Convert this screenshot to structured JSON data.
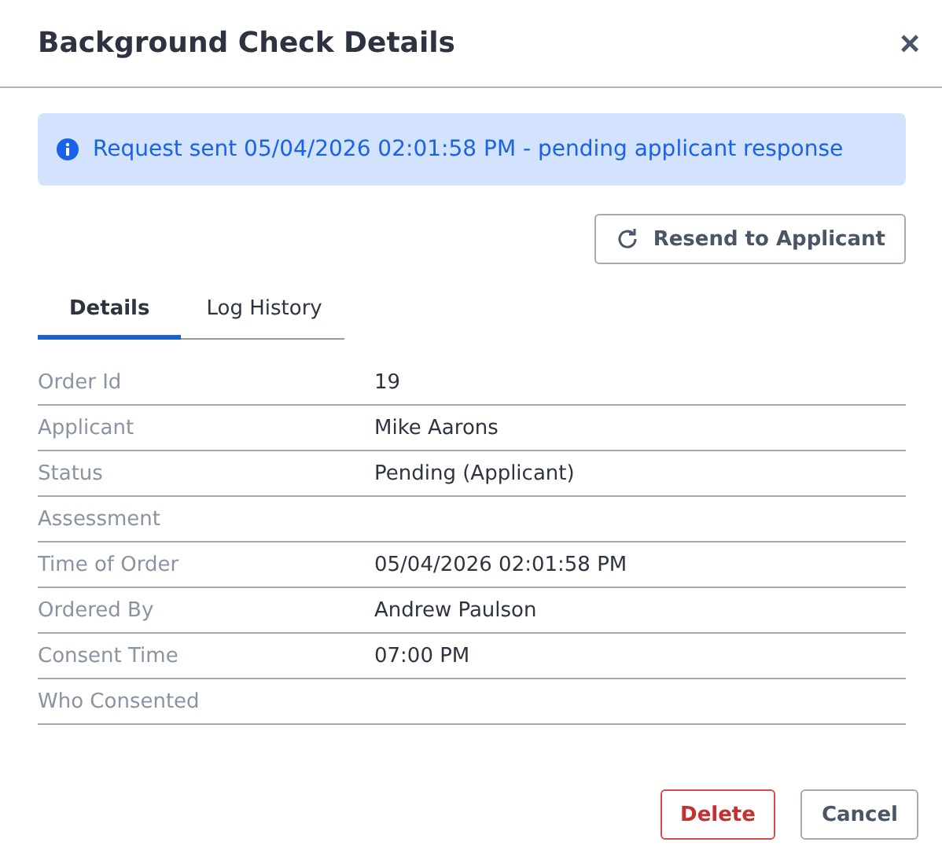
{
  "dialog": {
    "title": "Background Check Details",
    "close": "×"
  },
  "alert": {
    "text": "Request sent 05/04/2026 02:01:58 PM - pending applicant response"
  },
  "resend_button": {
    "label": "Resend to Applicant"
  },
  "tabs": [
    {
      "label": "Details",
      "selected": true
    },
    {
      "label": "Log History",
      "selected": false
    }
  ],
  "details": [
    {
      "label": "Order Id",
      "value": "19"
    },
    {
      "label": "Applicant",
      "value": "Mike Aarons"
    },
    {
      "label": "Status",
      "value": "Pending (Applicant)"
    },
    {
      "label": "Assessment"
    },
    {
      "label": "Time of Order",
      "value": "05/04/2026 02:01:58 PM"
    },
    {
      "label": "Ordered By",
      "value": "Andrew Paulson"
    },
    {
      "label": "Consent Time",
      "value": "07:00 PM"
    },
    {
      "label": "Who Consented"
    }
  ],
  "buttons": [
    {
      "label": "Delete",
      "kind": "danger"
    },
    {
      "label": "Cancel",
      "kind": "default"
    }
  ]
}
